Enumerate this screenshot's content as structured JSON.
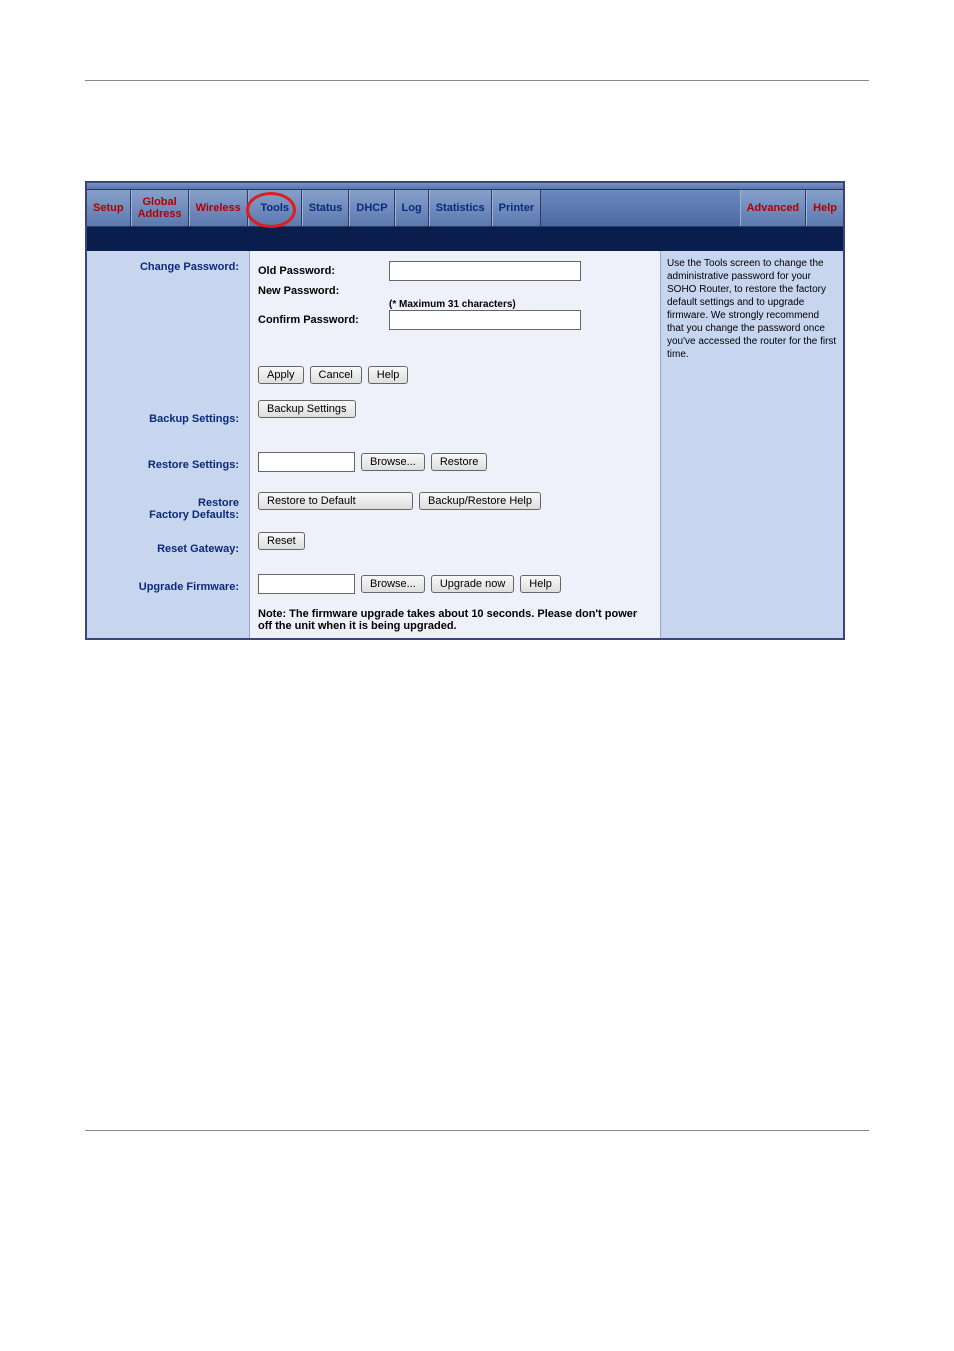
{
  "tabs": {
    "setup": "Setup",
    "global1": "Global",
    "global2": "Address",
    "wireless": "Wireless",
    "tools": "Tools",
    "status": "Status",
    "dhcp": "DHCP",
    "log": "Log",
    "statistics": "Statistics",
    "printer": "Printer",
    "advanced": "Advanced",
    "help": "Help"
  },
  "labels": {
    "change_password": "Change Password:",
    "backup_settings": "Backup Settings:",
    "restore_settings": "Restore Settings:",
    "restore_factory1": "Restore",
    "restore_factory2": "Factory Defaults:",
    "reset_gateway": "Reset Gateway:",
    "upgrade_firmware": "Upgrade Firmware:"
  },
  "fields": {
    "old_password": "Old Password:",
    "new_password": "New Password:",
    "confirm_password": "Confirm Password:",
    "max_chars": "(* Maximum 31 characters)"
  },
  "buttons": {
    "apply": "Apply",
    "cancel": "Cancel",
    "help": "Help",
    "backup_settings": "Backup Settings",
    "browse": "Browse...",
    "restore": "Restore",
    "restore_default": "Restore to Default",
    "backup_restore_help": "Backup/Restore Help",
    "reset": "Reset",
    "upgrade_now": "Upgrade now",
    "help2": "Help"
  },
  "note": "Note: The firmware upgrade takes about 10 seconds. Please don't power off the unit when it is being upgraded.",
  "help_text": "Use the Tools screen to change the administrative password for your SOHO Router, to restore the factory default settings and to upgrade firmware. We strongly recommend that you change the password once you've accessed the router for the first time."
}
